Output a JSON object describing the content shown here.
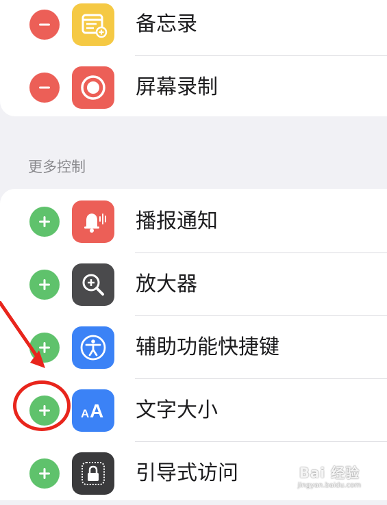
{
  "top_group": {
    "items": [
      {
        "label": "备忘录",
        "icon": "notes-icon",
        "action": "remove"
      },
      {
        "label": "屏幕录制",
        "icon": "screen-recording-icon",
        "action": "remove"
      }
    ]
  },
  "more_controls": {
    "header": "更多控制",
    "items": [
      {
        "label": "播报通知",
        "icon": "announce-notifications-icon",
        "action": "add"
      },
      {
        "label": "放大器",
        "icon": "magnifier-icon",
        "action": "add"
      },
      {
        "label": "辅助功能快捷键",
        "icon": "accessibility-shortcut-icon",
        "action": "add"
      },
      {
        "label": "文字大小",
        "icon": "text-size-icon",
        "action": "add"
      },
      {
        "label": "引导式访问",
        "icon": "guided-access-icon",
        "action": "add"
      }
    ]
  },
  "watermark": {
    "main": "Bai 经验",
    "sub": "jingyan.baidu.com"
  },
  "colors": {
    "remove": "#ec5f57",
    "add": "#5fc26c",
    "notes": "#f5c944",
    "screen_recording": "#ec5f57",
    "announce": "#ec5f57",
    "magnifier": "#4a4a4c",
    "accessibility": "#3b82f6",
    "text_size": "#3b82f6",
    "guided_access": "#3a3a3c",
    "annotation": "#e8251c"
  }
}
